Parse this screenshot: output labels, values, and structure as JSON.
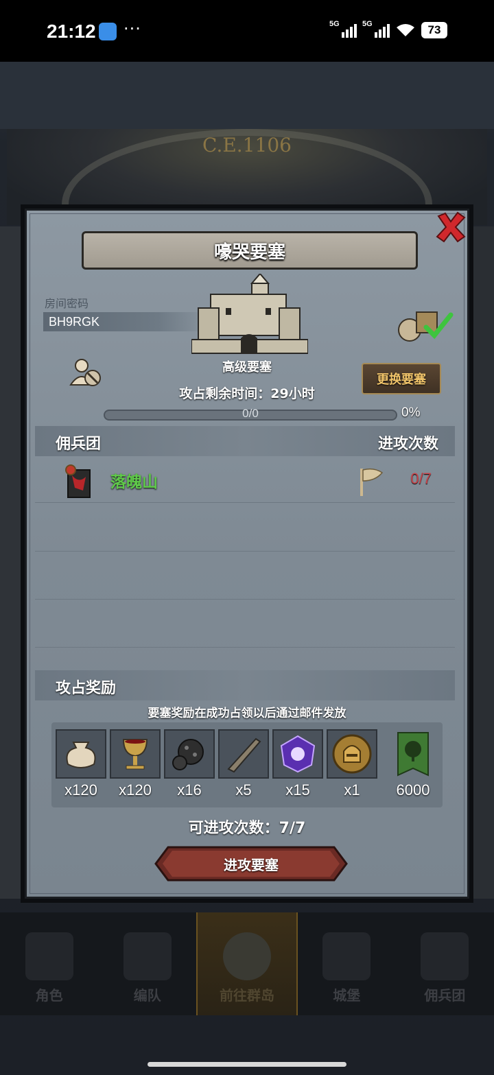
{
  "status_bar": {
    "time": "21:12",
    "dots": "···",
    "signal1_label": "5G",
    "signal2_label": "5G",
    "battery": "73"
  },
  "background": {
    "era_label": "C.E.1106"
  },
  "modal": {
    "title": "嚎哭要塞",
    "room_code_label": "房间密码",
    "room_code": "BH9RGK",
    "fortress_type": "高级要塞",
    "change_button": "更换要塞",
    "time_remaining": "攻占剩余时间：29小时",
    "progress_text": "0/0",
    "progress_percent": "0%",
    "progress_fraction": 0,
    "mercenary_header": "佣兵团",
    "attack_count_header": "进攻次数",
    "mercenaries": [
      {
        "name": "落魄山",
        "attacks": "0/7"
      }
    ],
    "reward_header": "攻占奖励",
    "reward_note": "要塞奖励在成功占领以后通过邮件发放",
    "rewards": [
      {
        "icon": "coin-sack-icon",
        "qty": "x120"
      },
      {
        "icon": "goblet-icon",
        "qty": "x120"
      },
      {
        "icon": "ore-icon",
        "qty": "x16"
      },
      {
        "icon": "horn-icon",
        "qty": "x5"
      },
      {
        "icon": "purple-crystal-icon",
        "qty": "x15"
      },
      {
        "icon": "helmet-medal-icon",
        "qty": "x1"
      },
      {
        "icon": "guild-banner-icon",
        "qty": "6000"
      }
    ],
    "attempts_left": "可进攻次数：7/7",
    "attack_button": "进攻要塞"
  },
  "bottom_nav": [
    {
      "label": "角色",
      "icon": "knight-icon"
    },
    {
      "label": "编队",
      "icon": "helmet-icon"
    },
    {
      "label": "前往群岛",
      "icon": "island-icon",
      "active": true
    },
    {
      "label": "城堡",
      "icon": "castle-icon"
    },
    {
      "label": "佣兵团",
      "icon": "mercenary-icon"
    }
  ],
  "colors": {
    "accent_gold": "#f1c46a",
    "merc_name": "#5fc84a",
    "attack_count": "#c8434a",
    "close_red": "#d0282c"
  }
}
